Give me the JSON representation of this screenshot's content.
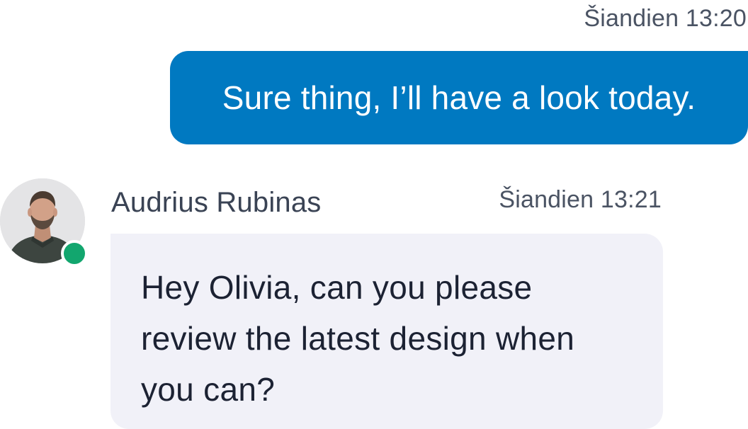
{
  "outgoing": {
    "timestamp": "Šiandien 13:20",
    "text": "Sure thing, I’ll have a look today.",
    "bubble_color": "#0079c1"
  },
  "incoming": {
    "sender": "Audrius Rubinas",
    "timestamp": "Šiandien 13:21",
    "text_lines": [
      "Hey Olivia, can you please",
      "review the latest design when",
      "you can?"
    ],
    "bubble_color": "#f1f1f8",
    "avatar_icon": "user-photo-avatar",
    "presence_status": "online",
    "presence_color": "#12a66e"
  }
}
